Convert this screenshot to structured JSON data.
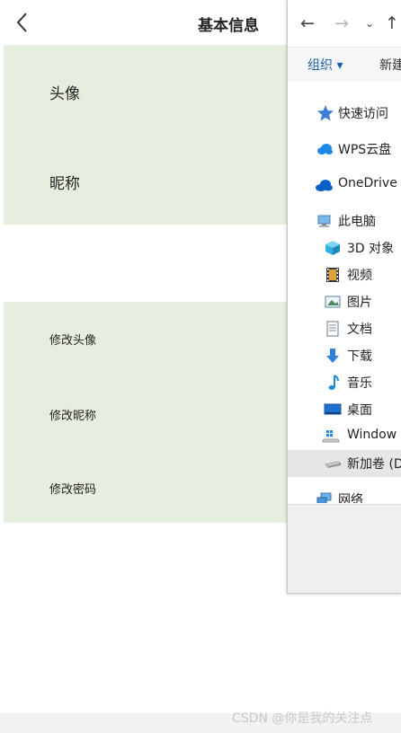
{
  "app": {
    "title": "基本信息",
    "info_rows": [
      {
        "label": "头像"
      },
      {
        "label": "昵称"
      }
    ],
    "action_rows": [
      {
        "label": "修改头像"
      },
      {
        "label": "修改昵称"
      },
      {
        "label": "修改密码"
      }
    ]
  },
  "file_dialog": {
    "toolbar": {
      "organize_label": "组织 ▾",
      "new_label": "新建"
    },
    "nav_tree": [
      {
        "label": "快速访问",
        "icon": "star-icon"
      },
      {
        "label": "WPS云盘",
        "icon": "cloud-icon"
      },
      {
        "label": "OneDrive",
        "icon": "cloud-icon"
      },
      {
        "label": "此电脑",
        "icon": "computer-icon"
      },
      {
        "label": "3D 对象",
        "icon": "cube-icon"
      },
      {
        "label": "视频",
        "icon": "film-icon"
      },
      {
        "label": "图片",
        "icon": "picture-icon"
      },
      {
        "label": "文档",
        "icon": "document-icon"
      },
      {
        "label": "下载",
        "icon": "download-arrow-icon"
      },
      {
        "label": "音乐",
        "icon": "music-note-icon"
      },
      {
        "label": "桌面",
        "icon": "desktop-icon"
      },
      {
        "label": "Window",
        "icon": "windows-drive-icon"
      },
      {
        "label": "新加卷 (D",
        "icon": "drive-icon",
        "selected": true
      },
      {
        "label": "网络",
        "icon": "network-icon"
      }
    ]
  },
  "watermark": "CSDN @你是我的关注点",
  "colors": {
    "panel_bg": "#e8eedf",
    "selected_bg": "#e6e6e6",
    "cloud_blue": "#1e88e5",
    "onedrive_blue": "#0a62c9",
    "star_blue": "#3d7fd6"
  }
}
